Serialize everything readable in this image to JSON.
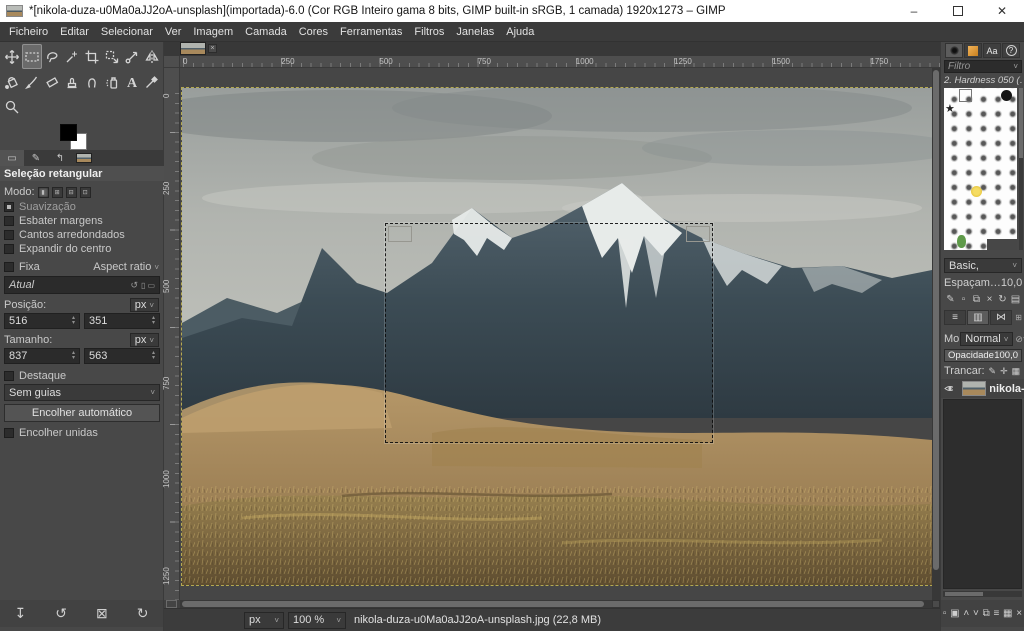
{
  "titlebar": {
    "title": "*[nikola-duza-u0Ma0aJJ2oA-unsplash](importada)-6.0 (Cor RGB Inteiro gama 8 bits, GIMP built-in sRGB, 1 camada) 1920x1273 – GIMP",
    "minimize": "–",
    "close": "✕"
  },
  "menubar": {
    "items": [
      "Ficheiro",
      "Editar",
      "Selecionar",
      "Ver",
      "Imagem",
      "Camada",
      "Cores",
      "Ferramentas",
      "Filtros",
      "Janelas",
      "Ajuda"
    ]
  },
  "toolbox": {
    "tools": [
      {
        "name": "move",
        "active": false
      },
      {
        "name": "rectangle-select",
        "active": true
      },
      {
        "name": "free-select",
        "active": false
      },
      {
        "name": "fuzzy-select",
        "active": false
      },
      {
        "name": "crop",
        "active": false
      },
      {
        "name": "unified-transform",
        "active": false
      },
      {
        "name": "handle-transform",
        "active": false
      },
      {
        "name": "flip",
        "active": false
      },
      {
        "name": "bucket-fill",
        "active": false
      },
      {
        "name": "paintbrush",
        "active": false
      },
      {
        "name": "eraser",
        "active": false
      },
      {
        "name": "clone",
        "active": false
      },
      {
        "name": "smudge",
        "active": false
      },
      {
        "name": "airbrush",
        "active": false
      },
      {
        "name": "text",
        "active": false
      },
      {
        "name": "color-picker",
        "active": false
      },
      {
        "name": "zoom",
        "active": false
      }
    ]
  },
  "tool_options": {
    "title": "Seleção retangular",
    "mode_label": "Modo:",
    "antialias": "Suavização",
    "feather": "Esbater margens",
    "rounded": "Cantos arredondados",
    "expand_center": "Expandir do centro",
    "fixed_label": "Fixa",
    "fixed_value": "Aspect ratio",
    "ratio_value": "Atual",
    "position_label": "Posição:",
    "position_unit": "px",
    "position_x": "516",
    "position_y": "351",
    "size_label": "Tamanho:",
    "size_unit": "px",
    "size_w": "837",
    "size_h": "563",
    "highlight": "Destaque",
    "guides": "Sem guias",
    "autoshrink": "Encolher automático",
    "shrink_merged": "Encolher unidas"
  },
  "left_bottom_buttons": [
    "save-preset",
    "restore-preset",
    "delete-preset",
    "reset-tool"
  ],
  "canvas": {
    "ruler_top": [
      "0",
      "250",
      "500",
      "750",
      "1000",
      "1250",
      "1500",
      "1750"
    ],
    "ruler_left": [
      "0",
      "250",
      "500",
      "750",
      "1000",
      "1250"
    ]
  },
  "statusbar": {
    "unit": "px",
    "zoom": "100 %",
    "filename": "nikola-duza-u0Ma0aJJ2oA-unsplash.jpg (22,8 MB)"
  },
  "right_panel": {
    "filter_placeholder": "Filtro",
    "brush_name": "2. Hardness 050 (…",
    "preset": "Basic,",
    "spacing_label": "Espaçam…",
    "spacing_value": "10,0",
    "mode_label": "Mo",
    "mode_value": "Normal",
    "opacity_label": "Opacidade",
    "opacity_value": "100,0",
    "lock_label": "Trancar:",
    "layer_name": "nikola-…",
    "brush_edit_icons": [
      "edit-brush",
      "new-brush",
      "duplicate-brush",
      "delete-brush",
      "refresh-brushes",
      "open-as-image"
    ],
    "bottom_icons": [
      "new-layer",
      "new-group",
      "raise-layer",
      "lower-layer",
      "duplicate-layer",
      "anchor-layer",
      "merge-layer",
      "delete-layer"
    ]
  },
  "colors": {
    "titlebar_bg": "#ffffff",
    "panel_bg": "#484848",
    "menubar_bg": "#3b3b3b",
    "input_bg": "#2b2b2b",
    "pattern_orange": "#e09a3c",
    "layer_boundary_dash": "#b5aa50"
  }
}
